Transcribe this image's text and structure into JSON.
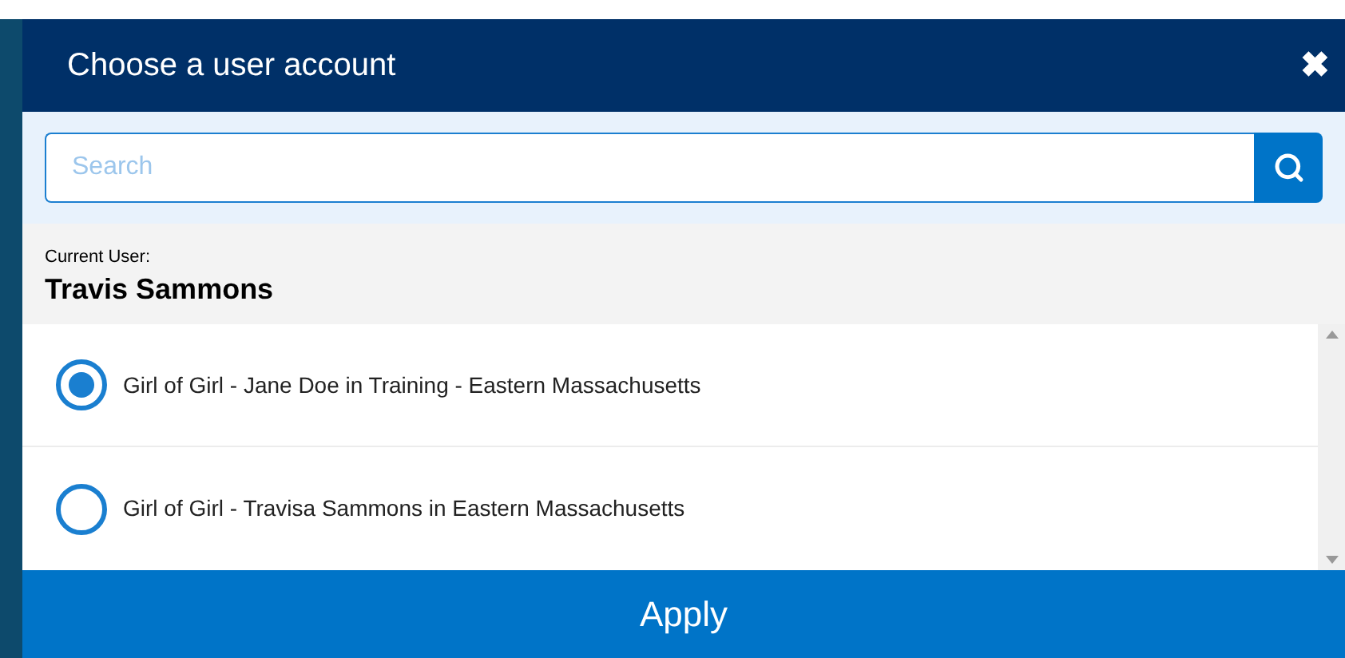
{
  "dialog": {
    "title": "Choose a user account",
    "close": "✖"
  },
  "search": {
    "placeholder": "Search"
  },
  "current_user": {
    "label": "Current User:",
    "name": "Travis Sammons"
  },
  "accounts": [
    {
      "label": "Girl of Girl - Jane Doe in Training - Eastern Massachusetts",
      "selected": true
    },
    {
      "label": "Girl of Girl - Travisa Sammons in Eastern Massachusetts",
      "selected": false
    }
  ],
  "apply": "Apply"
}
